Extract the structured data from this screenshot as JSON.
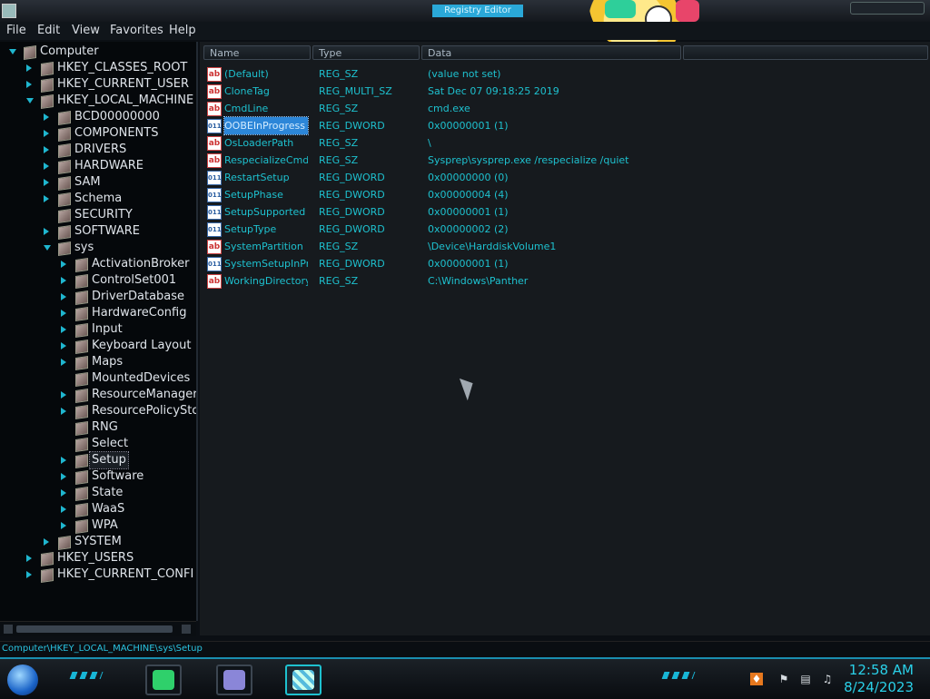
{
  "window": {
    "title": "Registry Editor"
  },
  "menu": [
    "File",
    "Edit",
    "View",
    "Favorites",
    "Help"
  ],
  "tree": [
    {
      "label": "Computer",
      "level": 0,
      "expander": "open"
    },
    {
      "label": "HKEY_CLASSES_ROOT",
      "level": 1,
      "expander": "closed"
    },
    {
      "label": "HKEY_CURRENT_USER",
      "level": 1,
      "expander": "closed"
    },
    {
      "label": "HKEY_LOCAL_MACHINE",
      "level": 1,
      "expander": "open"
    },
    {
      "label": "BCD00000000",
      "level": 2,
      "expander": "closed"
    },
    {
      "label": "COMPONENTS",
      "level": 2,
      "expander": "closed"
    },
    {
      "label": "DRIVERS",
      "level": 2,
      "expander": "closed"
    },
    {
      "label": "HARDWARE",
      "level": 2,
      "expander": "closed"
    },
    {
      "label": "SAM",
      "level": 2,
      "expander": "closed"
    },
    {
      "label": "Schema",
      "level": 2,
      "expander": "closed"
    },
    {
      "label": "SECURITY",
      "level": 2,
      "expander": "none"
    },
    {
      "label": "SOFTWARE",
      "level": 2,
      "expander": "closed"
    },
    {
      "label": "sys",
      "level": 2,
      "expander": "open"
    },
    {
      "label": "ActivationBroker",
      "level": 3,
      "expander": "closed"
    },
    {
      "label": "ControlSet001",
      "level": 3,
      "expander": "closed"
    },
    {
      "label": "DriverDatabase",
      "level": 3,
      "expander": "closed"
    },
    {
      "label": "HardwareConfig",
      "level": 3,
      "expander": "closed"
    },
    {
      "label": "Input",
      "level": 3,
      "expander": "closed"
    },
    {
      "label": "Keyboard Layout",
      "level": 3,
      "expander": "closed"
    },
    {
      "label": "Maps",
      "level": 3,
      "expander": "closed"
    },
    {
      "label": "MountedDevices",
      "level": 3,
      "expander": "none"
    },
    {
      "label": "ResourceManager",
      "level": 3,
      "expander": "closed"
    },
    {
      "label": "ResourcePolicySto",
      "level": 3,
      "expander": "closed"
    },
    {
      "label": "RNG",
      "level": 3,
      "expander": "none"
    },
    {
      "label": "Select",
      "level": 3,
      "expander": "none"
    },
    {
      "label": "Setup",
      "level": 3,
      "expander": "closed",
      "selected": true
    },
    {
      "label": "Software",
      "level": 3,
      "expander": "closed"
    },
    {
      "label": "State",
      "level": 3,
      "expander": "closed"
    },
    {
      "label": "WaaS",
      "level": 3,
      "expander": "closed"
    },
    {
      "label": "WPA",
      "level": 3,
      "expander": "closed"
    },
    {
      "label": "SYSTEM",
      "level": 2,
      "expander": "closed"
    },
    {
      "label": "HKEY_USERS",
      "level": 1,
      "expander": "closed"
    },
    {
      "label": "HKEY_CURRENT_CONFI",
      "level": 1,
      "expander": "closed"
    }
  ],
  "columns": [
    "Name",
    "Type",
    "Data"
  ],
  "values": [
    {
      "name": "(Default)",
      "type": "REG_SZ",
      "data": "(value not set)",
      "icon": "string"
    },
    {
      "name": "CloneTag",
      "type": "REG_MULTI_SZ",
      "data": "Sat Dec 07 09:18:25 2019",
      "icon": "string"
    },
    {
      "name": "CmdLine",
      "type": "REG_SZ",
      "data": "cmd.exe",
      "icon": "string"
    },
    {
      "name": "OOBEInProgress",
      "type": "REG_DWORD",
      "data": "0x00000001 (1)",
      "icon": "dword",
      "selected": true
    },
    {
      "name": "OsLoaderPath",
      "type": "REG_SZ",
      "data": "\\",
      "icon": "string"
    },
    {
      "name": "RespecializeCmd...",
      "type": "REG_SZ",
      "data": "Sysprep\\sysprep.exe /respecialize /quiet",
      "icon": "string"
    },
    {
      "name": "RestartSetup",
      "type": "REG_DWORD",
      "data": "0x00000000 (0)",
      "icon": "dword"
    },
    {
      "name": "SetupPhase",
      "type": "REG_DWORD",
      "data": "0x00000004 (4)",
      "icon": "dword"
    },
    {
      "name": "SetupSupported",
      "type": "REG_DWORD",
      "data": "0x00000001 (1)",
      "icon": "dword"
    },
    {
      "name": "SetupType",
      "type": "REG_DWORD",
      "data": "0x00000002 (2)",
      "icon": "dword"
    },
    {
      "name": "SystemPartition",
      "type": "REG_SZ",
      "data": "\\Device\\HarddiskVolume1",
      "icon": "string"
    },
    {
      "name": "SystemSetupInPr...",
      "type": "REG_DWORD",
      "data": "0x00000001 (1)",
      "icon": "dword"
    },
    {
      "name": "WorkingDirectory",
      "type": "REG_SZ",
      "data": "C:\\Windows\\Panther",
      "icon": "string"
    }
  ],
  "icon_glyphs": {
    "string": "ab",
    "dword": "011"
  },
  "status": {
    "path": "Computer\\HKEY_LOCAL_MACHINE\\sys\\Setup"
  },
  "taskbar": {
    "time": "12:58 AM",
    "date": "8/24/2023"
  },
  "colors": {
    "accent": "#1ec1cf",
    "selection": "#2c86d8"
  }
}
